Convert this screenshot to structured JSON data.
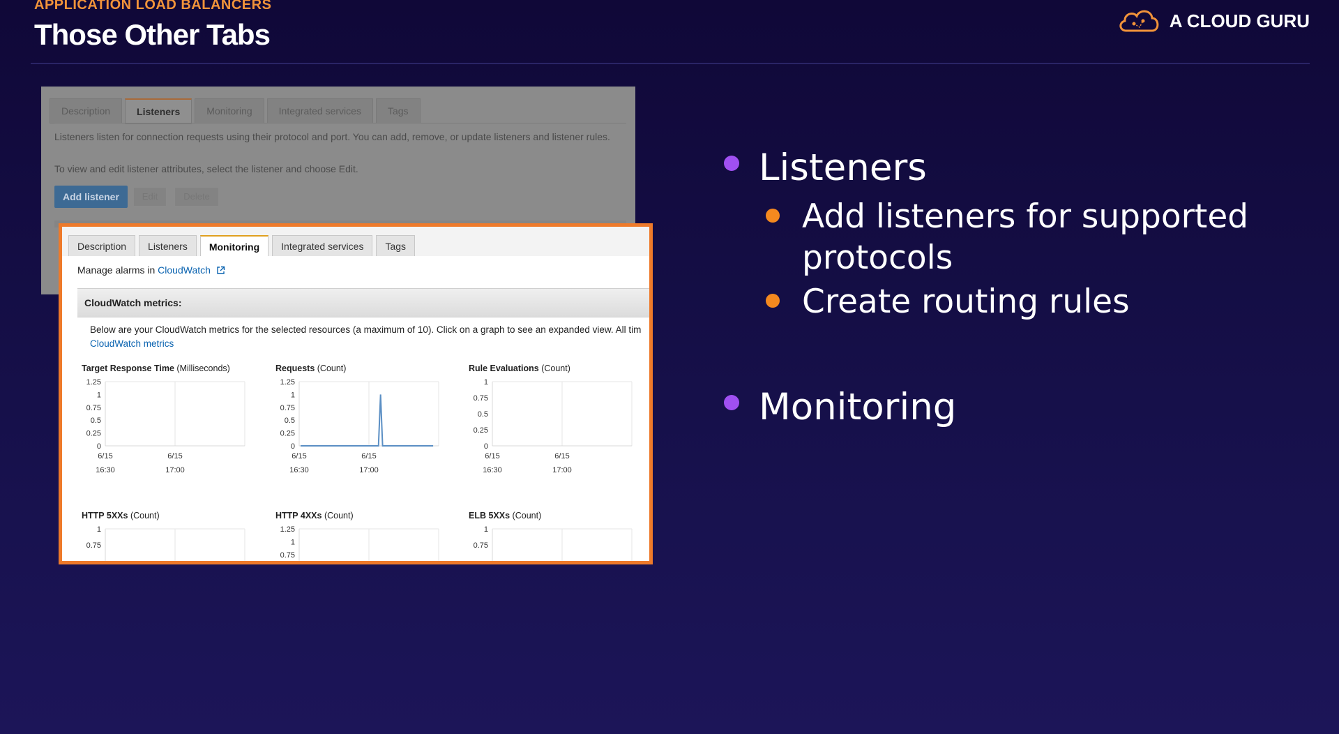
{
  "slide": {
    "eyebrow": "APPLICATION LOAD BALANCERS",
    "title": "Those Other Tabs",
    "logo_text": "A CLOUD GURU"
  },
  "bullets": [
    {
      "label": "Listeners",
      "children": [
        "Add listeners for supported protocols",
        "Create routing rules"
      ]
    },
    {
      "label": "Monitoring",
      "children": []
    }
  ],
  "listeners_view": {
    "tabs": [
      "Description",
      "Listeners",
      "Monitoring",
      "Integrated services",
      "Tags"
    ],
    "active_tab": "Listeners",
    "text1": "Listeners listen for connection requests using their protocol and port. You can add, remove, or update listeners and listener rules.",
    "text2": "To view and edit listener attributes, select the listener and choose Edit.",
    "add_button": "Add listener",
    "edit_button": "Edit",
    "delete_button": "Delete"
  },
  "monitoring_view": {
    "tabs": [
      "Description",
      "Listeners",
      "Monitoring",
      "Integrated services",
      "Tags"
    ],
    "active_tab": "Monitoring",
    "manage_prefix": "Manage alarms in",
    "manage_link": "CloudWatch",
    "metrics_header": "CloudWatch metrics:",
    "description": "Below are your CloudWatch metrics for the selected resources (a maximum of 10). Click on a graph to see an expanded view. All tim",
    "metrics_link": "CloudWatch metrics",
    "colors": {
      "line": "#5b8fc4",
      "tab_accent": "#e0a020",
      "frame": "#ee7a2a"
    }
  },
  "chart_data": [
    {
      "type": "line",
      "title": "Target Response Time",
      "unit": "(Milliseconds)",
      "y_ticks": [
        "1.25",
        "1",
        "0.75",
        "0.5",
        "0.25",
        "0"
      ],
      "ylim": [
        0,
        1.25
      ],
      "x_ticks": [
        [
          "6/15",
          "16:30"
        ],
        [
          "6/15",
          "17:00"
        ]
      ],
      "series": []
    },
    {
      "type": "line",
      "title": "Requests",
      "unit": "(Count)",
      "y_ticks": [
        "1.25",
        "1",
        "0.75",
        "0.5",
        "0.25",
        "0"
      ],
      "ylim": [
        0,
        1.25
      ],
      "x_ticks": [
        [
          "6/15",
          "16:30"
        ],
        [
          "6/15",
          "17:00"
        ]
      ],
      "series": [
        {
          "values": [
            [
              0,
              0
            ],
            [
              0.57,
              0
            ],
            [
              0.585,
              1
            ],
            [
              0.6,
              0
            ],
            [
              0.97,
              0
            ]
          ]
        }
      ]
    },
    {
      "type": "line",
      "title": "Rule Evaluations",
      "unit": "(Count)",
      "y_ticks": [
        "1",
        "0.75",
        "0.5",
        "0.25",
        "0"
      ],
      "ylim": [
        0,
        1
      ],
      "x_ticks": [
        [
          "6/15",
          "16:30"
        ],
        [
          "6/15",
          "17:00"
        ]
      ],
      "series": []
    },
    {
      "type": "line",
      "title": "HTTP 5XXs",
      "unit": "(Count)",
      "y_ticks": [
        "1",
        "0.75"
      ],
      "ylim": [
        0,
        1
      ],
      "x_ticks": [],
      "series": []
    },
    {
      "type": "line",
      "title": "HTTP 4XXs",
      "unit": "(Count)",
      "y_ticks": [
        "1.25",
        "1",
        "0.75"
      ],
      "ylim": [
        0,
        1.25
      ],
      "x_ticks": [],
      "series": []
    },
    {
      "type": "line",
      "title": "ELB 5XXs",
      "unit": "(Count)",
      "y_ticks": [
        "1",
        "0.75"
      ],
      "ylim": [
        0,
        1
      ],
      "x_ticks": [],
      "series": []
    }
  ]
}
